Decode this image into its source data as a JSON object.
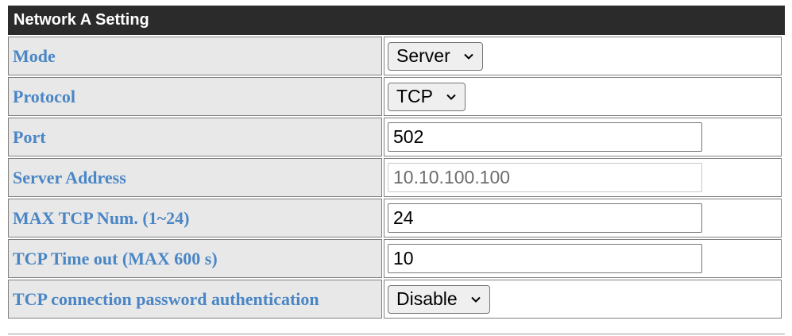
{
  "panel": {
    "title": "Network A Setting"
  },
  "rows": [
    {
      "label": "Mode",
      "type": "select",
      "value": "Server"
    },
    {
      "label": "Protocol",
      "type": "select",
      "value": "TCP"
    },
    {
      "label": "Port",
      "type": "input",
      "value": "502"
    },
    {
      "label": "Server Address",
      "type": "input-disabled",
      "value": "10.10.100.100"
    },
    {
      "label": "MAX TCP Num. (1~24)",
      "type": "input",
      "value": "24"
    },
    {
      "label": "TCP Time out (MAX 600 s)",
      "type": "input",
      "value": "10"
    },
    {
      "label": "TCP connection password authentication",
      "type": "select",
      "value": "Disable"
    }
  ],
  "colors": {
    "title_bg": "#2b2b2b",
    "label_bg": "#e8e8e8",
    "label_text": "#4a86c5"
  },
  "icons": {
    "select_arrow": "chevron-down-icon"
  }
}
